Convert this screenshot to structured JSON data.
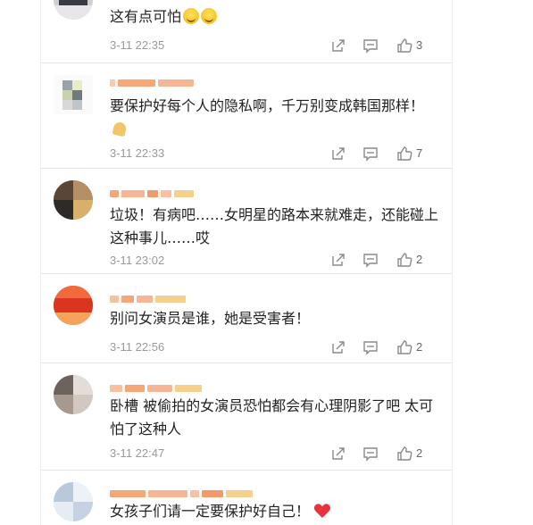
{
  "comments": [
    {
      "text": "这有点可怕",
      "emoji": [
        "smile-sweat",
        "smile-sweat"
      ],
      "time": "3-11 22:35",
      "likes": "3"
    },
    {
      "text": "要保护好每个人的隐私啊，千万别变成韩国那样！",
      "emoji": [
        "pray"
      ],
      "time": "3-11 22:33",
      "likes": "7"
    },
    {
      "text": "垃圾！有病吧……女明星的路本来就难走，还能碰上这种事儿……哎",
      "emoji": [],
      "time": "3-11 23:02",
      "likes": "2"
    },
    {
      "text": "别问女演员是谁，她是受害者！",
      "emoji": [],
      "time": "3-11 22:56",
      "likes": "2"
    },
    {
      "text": "卧槽 被偷拍的女演员恐怕都会有心理阴影了吧 太可怕了这种人",
      "emoji": [],
      "time": "3-11 22:47",
      "likes": "2"
    },
    {
      "text": "女孩子们请一定要保护好自己！",
      "emoji": [
        "red-heart"
      ],
      "time": "",
      "likes": ""
    }
  ],
  "icons": {
    "share": "share-icon",
    "comment": "comment-icon",
    "like": "like-icon"
  },
  "colors": {
    "text": "#222222",
    "meta": "#9a9a9a",
    "icon": "#8a8a8a",
    "heart": "#e8323c",
    "blur_orange": "#f6a77a"
  }
}
